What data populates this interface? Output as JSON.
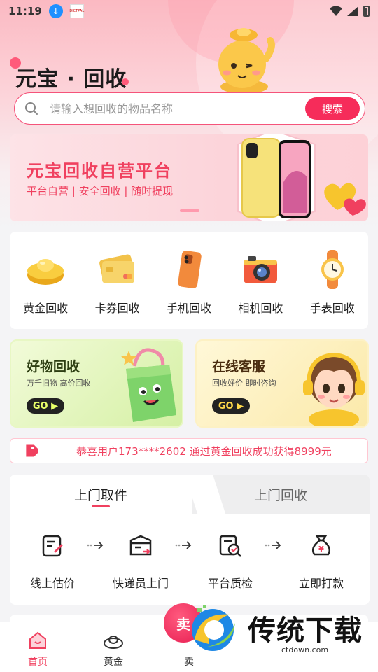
{
  "status_bar": {
    "time": "11:19",
    "app_icon_text": "DICTPAL"
  },
  "header": {
    "title": "元宝 · 回收"
  },
  "search": {
    "placeholder": "请输入想回收的物品名称",
    "button_label": "搜索"
  },
  "banner": {
    "title": "元宝回收自营平台",
    "subtitle": "平台自营 | 安全回收 | 随时提现"
  },
  "categories": [
    {
      "label": "黄金回收",
      "icon": "gold-ingot-icon"
    },
    {
      "label": "卡券回收",
      "icon": "card-icon"
    },
    {
      "label": "手机回收",
      "icon": "phone-icon"
    },
    {
      "label": "相机回收",
      "icon": "camera-icon"
    },
    {
      "label": "手表回收",
      "icon": "watch-icon"
    }
  ],
  "promos": {
    "left": {
      "title": "好物回收",
      "subtitle": "万千旧物 高价回收",
      "go_label": "GO"
    },
    "right": {
      "title": "在线客服",
      "subtitle": "回收好价 即时咨询",
      "go_label": "GO"
    }
  },
  "ticker": {
    "text": "恭喜用户173****2602 通过黄金回收成功获得8999元"
  },
  "service": {
    "tabs": [
      {
        "label": "上门取件"
      },
      {
        "label": "上门回收"
      }
    ],
    "steps": [
      {
        "label": "线上估价",
        "icon": "edit-form-icon"
      },
      {
        "label": "快递员上门",
        "icon": "package-icon"
      },
      {
        "label": "平台质检",
        "icon": "inspect-icon"
      },
      {
        "label": "立即打款",
        "icon": "money-bag-icon"
      }
    ]
  },
  "bottom_nav": {
    "items": [
      {
        "label": "首页"
      },
      {
        "label": "黄金"
      },
      {
        "label": "卖"
      }
    ],
    "center_button_label": "卖"
  },
  "watermark": {
    "text": "传统下载",
    "url": "ctdown.com"
  },
  "colors": {
    "accent": "#f62c5a",
    "banner_text": "#f0405f"
  }
}
